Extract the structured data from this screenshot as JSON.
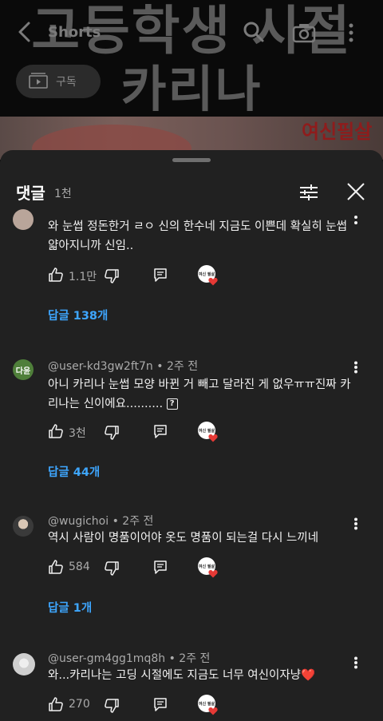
{
  "video": {
    "overlay_line1": "고등학생 시절",
    "overlay_line2": "카리나",
    "shorts_label": "Shorts",
    "subscribe_label": "구독",
    "red_caption": "여신필살"
  },
  "comments_panel": {
    "title": "댓글",
    "count": "1천",
    "creator_badge_text": "여신 필살"
  },
  "comments": [
    {
      "text": "와 눈썹 정돈한거 ㄹㅇ 신의 한수네 지금도 이쁜데 확실히 눈썹 얇아지니까 신임..",
      "likes": "1.1만",
      "replies_label": "답글 138개"
    },
    {
      "avatar_text": "다윤",
      "author": "@user-kd3gw2ft7n",
      "time": "2주 전",
      "text": "아니 카리나 눈썹 모양 바뀐 거 빼고 달라진 게 없우ㅠㅠ진짜 카리나는 신이에요..........",
      "text_tail": "?",
      "likes": "3천",
      "replies_label": "답글 44개"
    },
    {
      "author": "@wugichoi",
      "time": "2주 전",
      "text": "역시 사람이 명품이어야 옷도 명품이 되는걸 다시 느끼네",
      "likes": "584",
      "replies_label": "답글 1개"
    },
    {
      "author": "@user-gm4gg1mq8h",
      "time": "2주 전",
      "text": "와...카리나는 고딩 시절에도 지금도 너무 여신이자냥",
      "text_emoji": "❤️",
      "likes": "270"
    }
  ],
  "colors": {
    "sheet_bg": "#212121",
    "link_blue": "#3ea6ff",
    "heart_red": "#e53935"
  }
}
